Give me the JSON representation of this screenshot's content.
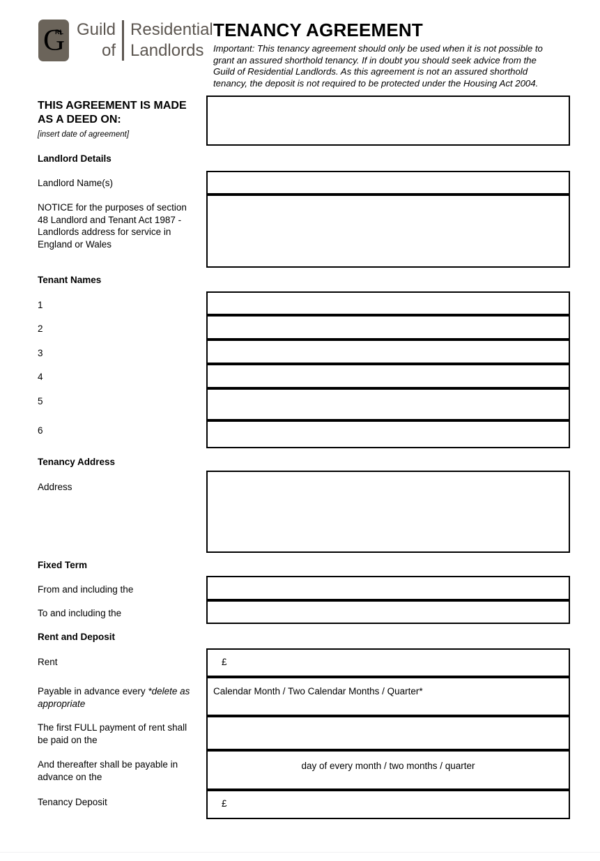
{
  "document": {
    "title": "TENANCY AGREEMENT",
    "important_note": "Important: This tenancy agreement should only be used when it is not possible to grant an assured shorthold tenancy. If in doubt you should seek advice from the Guild of Residential Landlords. As this agreement is not an assured shorthold tenancy, the deposit is not required to be protected under the Housing Act 2004."
  },
  "logo": {
    "mark_letter": "G",
    "mark_superscript": "RL",
    "line1_left": "Guild",
    "line1_right": "Residential",
    "line2_left": "of",
    "line2_right": "Landlords",
    "mark_color": "#6b645a",
    "text_color": "#5c5650"
  },
  "sections": {
    "deed_date": {
      "label": "THIS AGREEMENT IS MADE AS A DEED ON:",
      "hint": "[insert date of agreement]",
      "field_value": ""
    },
    "landlord_details": {
      "heading": "Landlord Details",
      "name_label": "Landlord Name(s)",
      "name_value": "",
      "notice_label": "NOTICE for the purposes of section 48 Landlord and Tenant Act 1987 - Landlords address for service in England or Wales",
      "notice_value": ""
    },
    "tenant_names": {
      "heading": "Tenant Names",
      "rows": [
        {
          "number": "1",
          "value": ""
        },
        {
          "number": "2",
          "value": ""
        },
        {
          "number": "3",
          "value": ""
        },
        {
          "number": "4",
          "value": ""
        },
        {
          "number": "5",
          "value": ""
        },
        {
          "number": "6",
          "value": ""
        }
      ]
    },
    "tenancy_address": {
      "heading": "Tenancy Address",
      "address_label": "Address",
      "address_value": ""
    },
    "fixed_term": {
      "heading": "Fixed Term",
      "from_label": "From and including the",
      "from_value": "",
      "to_label": "To and including the",
      "to_value": ""
    },
    "rent_and_deposit": {
      "heading": "Rent and Deposit",
      "rent_label": "Rent",
      "rent_currency": "£",
      "rent_value": "",
      "payable_label_plain": "Payable in advance every ",
      "payable_label_italic": "*delete as appropriate",
      "payable_options": "Calendar Month / Two Calendar Months / Quarter*",
      "first_full_label": "The first FULL payment of rent shall be paid on the",
      "first_full_value": "",
      "thereafter_label": "And thereafter shall be payable in advance on the",
      "thereafter_value": "day of every month / two months / quarter",
      "deposit_label": "Tenancy Deposit",
      "deposit_currency": "£",
      "deposit_value": ""
    }
  }
}
